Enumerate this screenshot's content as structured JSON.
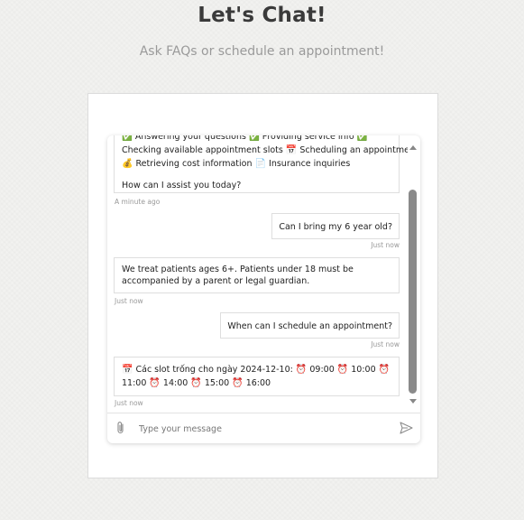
{
  "page": {
    "title": "Let's Chat!",
    "subtitle": "Ask FAQs or schedule an appointment!"
  },
  "chat": {
    "messages": [
      {
        "sender": "bot",
        "line_partial": "✅ Answering your questions  ✅ Providing service info  ✅",
        "line1": "Checking available appointment slots",
        "line1_icon": "📅",
        "line1_tail": "Scheduling an appointment",
        "line2_icon": "💰",
        "line2": "Retrieving cost information",
        "line2_icon2": "📄",
        "line2_tail": "Insurance inquiries",
        "line3": "How can I assist you today?",
        "time": "A minute ago"
      },
      {
        "sender": "user",
        "text": "Can I bring my 6 year old?",
        "time": "Just now"
      },
      {
        "sender": "bot",
        "text": "We treat patients ages 6+. Patients under 18 must be accompanied by a parent or legal guardian.",
        "time": "Just now"
      },
      {
        "sender": "user",
        "text": "When can I schedule an appointment?",
        "time": "Just now"
      },
      {
        "sender": "bot",
        "icon": "📅",
        "text": "Các slot trống cho ngày 2024-12-10:",
        "slots": [
          "09:00",
          "10:00",
          "11:00",
          "14:00",
          "15:00",
          "16:00"
        ],
        "slot_icon": "⏰",
        "time": "Just now"
      }
    ],
    "composer": {
      "placeholder": "Type your message",
      "attach_icon": "paperclip-icon",
      "send_icon": "send-icon"
    }
  },
  "colors": {
    "background": "#f2f2f0",
    "card": "#ffffff",
    "title": "#3a3a3a",
    "subtitle": "#9a9a9a",
    "scrollbar": "#8a8a8a"
  }
}
